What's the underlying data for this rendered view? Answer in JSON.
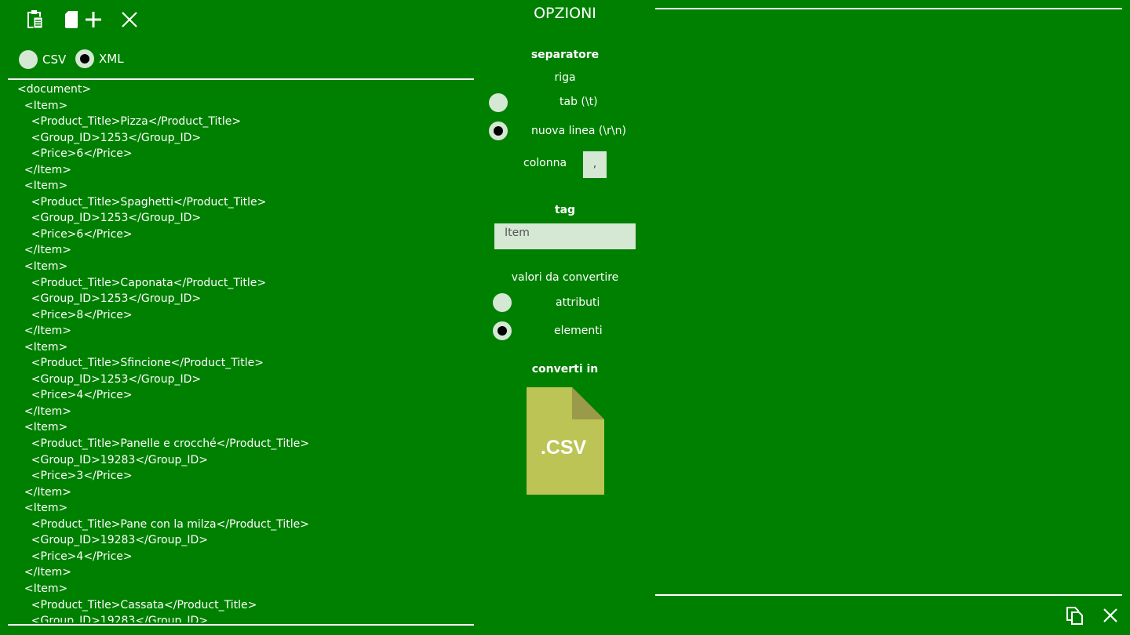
{
  "toolbar": {
    "paste_icon": "clipboard-icon",
    "new_icon": "new-document-plus-icon",
    "clear_icon": "close-icon"
  },
  "format": {
    "options": [
      {
        "label": "CSV",
        "selected": false
      },
      {
        "label": "XML",
        "selected": true
      }
    ]
  },
  "input_lines": [
    "<document>",
    "  <Item>",
    "    <Product_Title>Pizza</Product_Title>",
    "    <Group_ID>1253</Group_ID>",
    "    <Price>6</Price>",
    "  </Item>",
    "  <Item>",
    "    <Product_Title>Spaghetti</Product_Title>",
    "    <Group_ID>1253</Group_ID>",
    "    <Price>6</Price>",
    "  </Item>",
    "  <Item>",
    "    <Product_Title>Caponata</Product_Title>",
    "    <Group_ID>1253</Group_ID>",
    "    <Price>8</Price>",
    "  </Item>",
    "  <Item>",
    "    <Product_Title>Sfincione</Product_Title>",
    "    <Group_ID>1253</Group_ID>",
    "    <Price>4</Price>",
    "  </Item>",
    "  <Item>",
    "    <Product_Title>Panelle e crocché</Product_Title>",
    "    <Group_ID>19283</Group_ID>",
    "    <Price>3</Price>",
    "  </Item>",
    "  <Item>",
    "    <Product_Title>Pane con la milza</Product_Title>",
    "    <Group_ID>19283</Group_ID>",
    "    <Price>4</Price>",
    "  </Item>",
    "  <Item>",
    "    <Product_Title>Cassata</Product_Title>",
    "    <Group_ID>19283</Group_ID>"
  ],
  "options": {
    "title": "OPZIONI",
    "separator_heading": "separatore",
    "row_label": "riga",
    "row_options": [
      {
        "label": "tab (\\t)",
        "selected": false
      },
      {
        "label": "nuova linea (\\r\\n)",
        "selected": true
      }
    ],
    "column_label": "colonna",
    "column_value": ",",
    "tag_heading": "tag",
    "tag_value": "Item",
    "values_label": "valori da convertire",
    "value_options": [
      {
        "label": "attributi",
        "selected": false
      },
      {
        "label": "elementi",
        "selected": true
      }
    ],
    "convert_heading": "converti in",
    "convert_button_label": ".CSV",
    "convert_icon": "csv-file-icon"
  },
  "output": {
    "text": "",
    "copy_icon": "copy-icon",
    "clear_icon": "close-icon"
  },
  "colors": {
    "background": "#008000",
    "radio_fill": "#d4e8d4",
    "input_fill": "#d4e8d4",
    "file_icon": "#bbc455",
    "file_icon_fold": "#9a9a4a"
  }
}
